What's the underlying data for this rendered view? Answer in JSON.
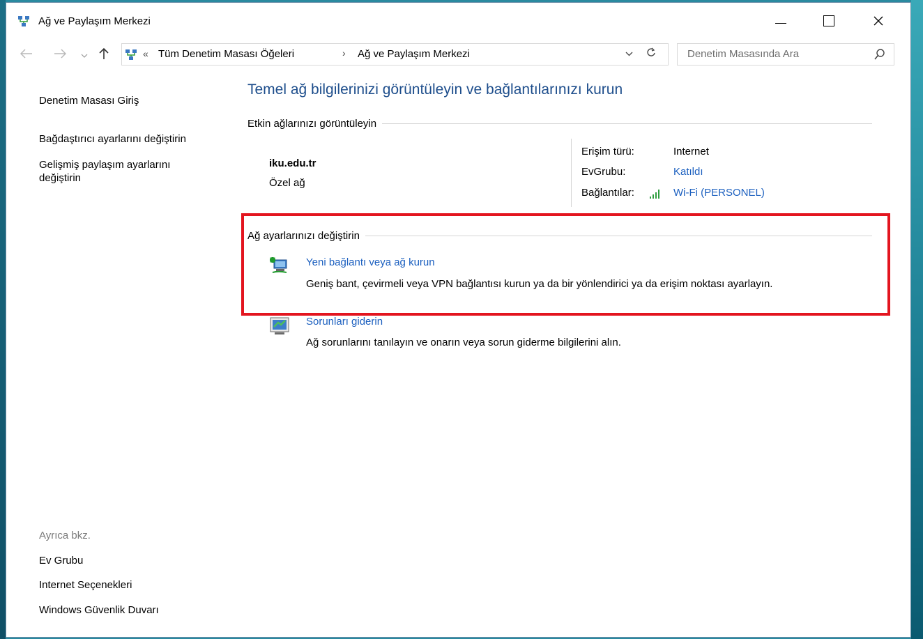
{
  "window": {
    "title": "Ağ ve Paylaşım Merkezi",
    "controls": {
      "minimize": "–",
      "maximize": "☐",
      "close": "✕"
    }
  },
  "nav": {
    "back_icon": "arrow-left-icon",
    "forward_icon": "arrow-right-icon",
    "up_icon": "arrow-up-icon",
    "address": {
      "overflow": "«",
      "crumbs": [
        "Tüm Denetim Masası Öğeleri",
        "Ağ ve Paylaşım Merkezi"
      ],
      "separator": "›"
    },
    "search_placeholder": "Denetim Masasında Ara"
  },
  "sidebar": {
    "home": "Denetim Masası Giriş",
    "adapter": "Bağdaştırıcı ayarlarını değiştirin",
    "sharing": "Gelişmiş paylaşım ayarlarını değiştirin",
    "see_also_label": "Ayrıca bkz.",
    "see_also": [
      "Ev Grubu",
      "Internet Seçenekleri",
      "Windows Güvenlik Duvarı"
    ]
  },
  "main": {
    "title": "Temel ağ bilgilerinizi görüntüleyin ve bağlantılarınızı kurun",
    "active_networks_heading": "Etkin ağlarınızı görüntüleyin",
    "network": {
      "name": "iku.edu.tr",
      "type": "Özel ağ",
      "access_label": "Erişim türü:",
      "access_value": "Internet",
      "homegroup_label": "EvGrubu:",
      "homegroup_value": "Katıldı",
      "connections_label": "Bağlantılar:",
      "connections_value": "Wi-Fi (PERSONEL)"
    },
    "change_heading": "Ağ ayarlarınızı değiştirin",
    "tasks": [
      {
        "title": "Yeni bağlantı veya ağ kurun",
        "desc": "Geniş bant, çevirmeli veya VPN bağlantısı kurun ya da bir yönlendirici ya da erişim noktası ayarlayın.",
        "icon": "new-connection-icon"
      },
      {
        "title": "Sorunları giderin",
        "desc": "Ağ sorunlarını tanılayın ve onarın veya sorun giderme bilgilerini alın.",
        "icon": "troubleshoot-icon"
      }
    ]
  },
  "colors": {
    "link": "#1b5fbf",
    "title": "#1e4e8c",
    "highlight": "#e3151f"
  }
}
